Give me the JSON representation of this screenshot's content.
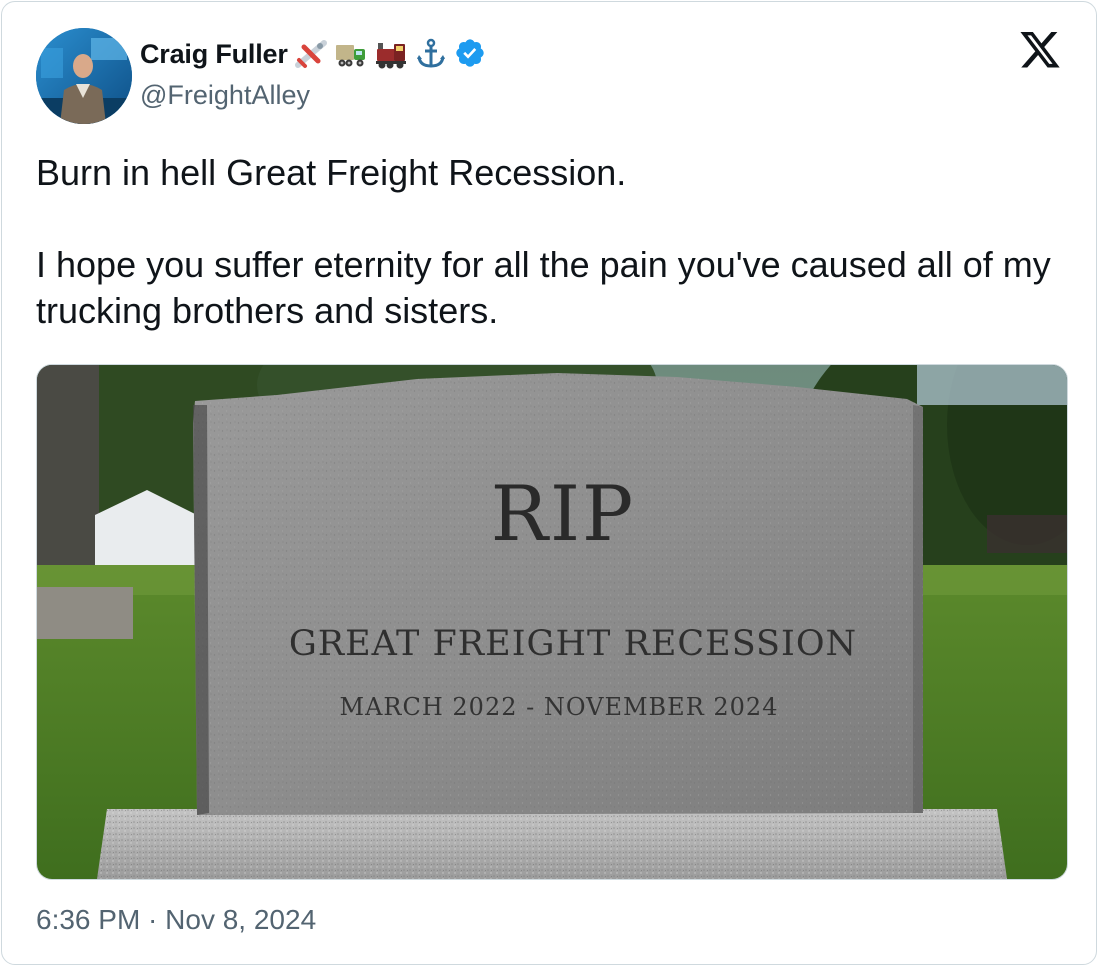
{
  "author": {
    "display_name": "Craig Fuller",
    "handle": "@FreightAlley",
    "verified": true,
    "name_emojis": [
      "airplane-icon",
      "truck-icon",
      "locomotive-icon",
      "anchor-icon"
    ],
    "verified_color": "#1d9bf0"
  },
  "platform": {
    "logo": "x-logo-icon"
  },
  "tweet": {
    "paragraphs": [
      "Burn in hell Great Freight Recession.",
      "I hope you suffer eternity for all the pain you've caused all of my trucking brothers and sisters."
    ],
    "timestamp": "6:36 PM · Nov 8, 2024"
  },
  "media": {
    "gravestone": {
      "title": "RIP",
      "line1": "GREAT FREIGHT RECESSION",
      "line2": "MARCH 2022 - NOVEMBER 2024"
    }
  },
  "colors": {
    "text": "#0f1419",
    "secondary_text": "#536471",
    "border": "#cfd9de"
  }
}
